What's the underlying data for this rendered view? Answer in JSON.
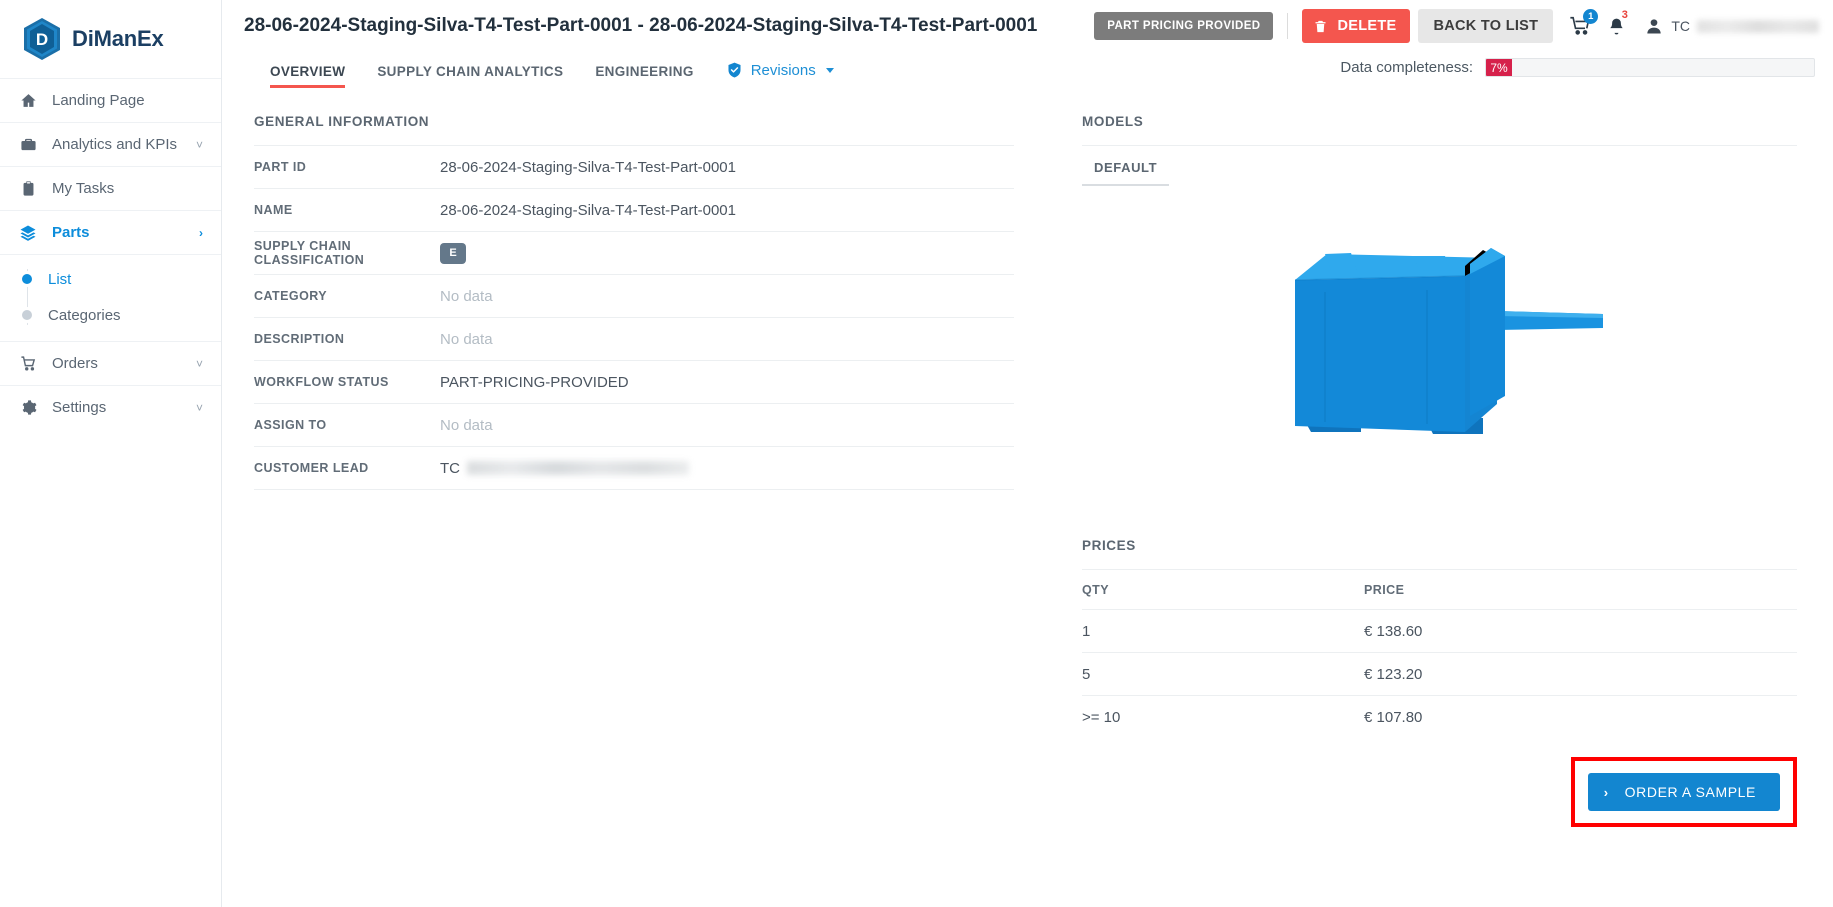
{
  "brand": {
    "name": "DiManEx",
    "logo_icon": "dimanex-hexagon-logo"
  },
  "sidebar": {
    "items": [
      {
        "label": "Landing Page",
        "icon": "home-icon",
        "chevron": "",
        "active": false
      },
      {
        "label": "Analytics and KPIs",
        "icon": "briefcase-icon",
        "chevron": "˅",
        "active": false
      },
      {
        "label": "My Tasks",
        "icon": "clipboard-icon",
        "chevron": "",
        "active": false
      },
      {
        "label": "Parts",
        "icon": "layers-icon",
        "chevron": "›",
        "active": true
      }
    ],
    "subitems": [
      {
        "label": "List",
        "active": true
      },
      {
        "label": "Categories",
        "active": false
      }
    ],
    "items_after": [
      {
        "label": "Orders",
        "icon": "cart-icon",
        "chevron": "˅",
        "active": false
      },
      {
        "label": "Settings",
        "icon": "gear-icon",
        "chevron": "˅",
        "active": false
      }
    ]
  },
  "topbar": {
    "title": "28-06-2024-Staging-Silva-T4-Test-Part-0001 - 28-06-2024-Staging-Silva-T4-Test-Part-0001",
    "status_chip": "PART PRICING PROVIDED",
    "delete_label": "DELETE",
    "back_label": "BACK TO LIST",
    "cart_badge": "1",
    "bell_badge": "3",
    "user_initials": "TC"
  },
  "tabs": [
    {
      "label": "OVERVIEW",
      "active": true
    },
    {
      "label": "SUPPLY CHAIN ANALYTICS",
      "active": false
    },
    {
      "label": "ENGINEERING",
      "active": false
    }
  ],
  "revisions": {
    "label": "Revisions",
    "icon": "shield-check-icon"
  },
  "completeness": {
    "label": "Data completeness:",
    "value": "7%",
    "percent": 7,
    "color": "#d6214b"
  },
  "general_information": {
    "title": "GENERAL INFORMATION",
    "rows": [
      {
        "label": "PART ID",
        "value": "28-06-2024-Staging-Silva-T4-Test-Part-0001",
        "type": "text"
      },
      {
        "label": "NAME",
        "value": "28-06-2024-Staging-Silva-T4-Test-Part-0001",
        "type": "text"
      },
      {
        "label": "SUPPLY CHAIN CLASSIFICATION",
        "value": "E",
        "type": "badge"
      },
      {
        "label": "CATEGORY",
        "value": "No data",
        "type": "nodata"
      },
      {
        "label": "DESCRIPTION",
        "value": "No data",
        "type": "nodata"
      },
      {
        "label": "WORKFLOW STATUS",
        "value": "PART-PRICING-PROVIDED",
        "type": "text"
      },
      {
        "label": "ASSIGN TO",
        "value": "No data",
        "type": "nodata"
      },
      {
        "label": "CUSTOMER LEAD",
        "value": "TC",
        "type": "redacted"
      }
    ]
  },
  "models": {
    "title": "MODELS",
    "tabs": [
      {
        "label": "DEFAULT",
        "active": true
      }
    ],
    "viewer_icon": "3d-part-model"
  },
  "prices": {
    "title": "PRICES",
    "headers": {
      "qty": "QTY",
      "price": "PRICE"
    },
    "rows": [
      {
        "qty": "1",
        "price": "€ 138.60"
      },
      {
        "qty": "5",
        "price": "€ 123.20"
      },
      {
        "qty": ">= 10",
        "price": "€ 107.80"
      }
    ],
    "order_button": {
      "label": "ORDER A SAMPLE",
      "arrow": "›",
      "highlighted": true
    }
  },
  "colors": {
    "accent_blue": "#1386d0",
    "delete_red": "#f4564e",
    "active_tab_underline": "#f4564e",
    "completeness_red": "#d6214b",
    "badge_slate": "#64788a",
    "highlight_border": "#ff0000"
  }
}
